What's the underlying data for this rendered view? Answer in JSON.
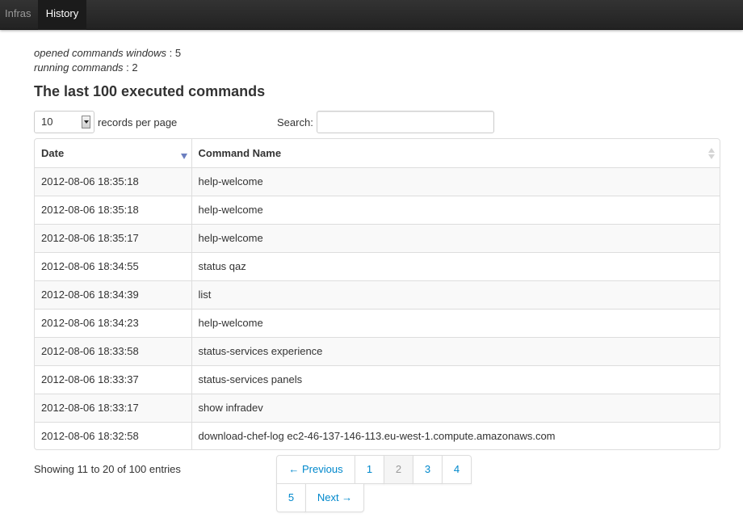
{
  "nav": {
    "items": [
      {
        "label": "Infras",
        "active": false
      },
      {
        "label": "History",
        "active": true
      }
    ]
  },
  "stats": {
    "opened_label": "opened commands windows",
    "opened_value": "5",
    "running_label": "running commands",
    "running_value": "2"
  },
  "heading": "The last 100 executed commands",
  "length": {
    "value": "10",
    "label": "records per page"
  },
  "search": {
    "label": "Search:",
    "value": "",
    "placeholder": ""
  },
  "table": {
    "headers": [
      "Date",
      "Command Name"
    ],
    "sort": {
      "Date": "desc",
      "Command Name": "none"
    },
    "rows": [
      [
        "2012-08-06 18:35:18",
        "help-welcome"
      ],
      [
        "2012-08-06 18:35:18",
        "help-welcome"
      ],
      [
        "2012-08-06 18:35:17",
        "help-welcome"
      ],
      [
        "2012-08-06 18:34:55",
        "status qaz"
      ],
      [
        "2012-08-06 18:34:39",
        "list"
      ],
      [
        "2012-08-06 18:34:23",
        "help-welcome"
      ],
      [
        "2012-08-06 18:33:58",
        "status-services experience"
      ],
      [
        "2012-08-06 18:33:37",
        "status-services panels"
      ],
      [
        "2012-08-06 18:33:17",
        "show infradev"
      ],
      [
        "2012-08-06 18:32:58",
        "download-chef-log ec2-46-137-146-113.eu-west-1.compute.amazonaws.com"
      ]
    ]
  },
  "info": "Showing 11 to 20 of 100 entries",
  "pagination": {
    "previous": "← Previous",
    "pages": [
      "1",
      "2",
      "3",
      "4",
      "5"
    ],
    "current": "2",
    "next": "Next →"
  },
  "colors": {
    "navbar": "#222222",
    "link": "#0088cc",
    "sort_active": "#6c7fc0",
    "stripe": "#f9f9f9",
    "border": "#dddddd"
  }
}
